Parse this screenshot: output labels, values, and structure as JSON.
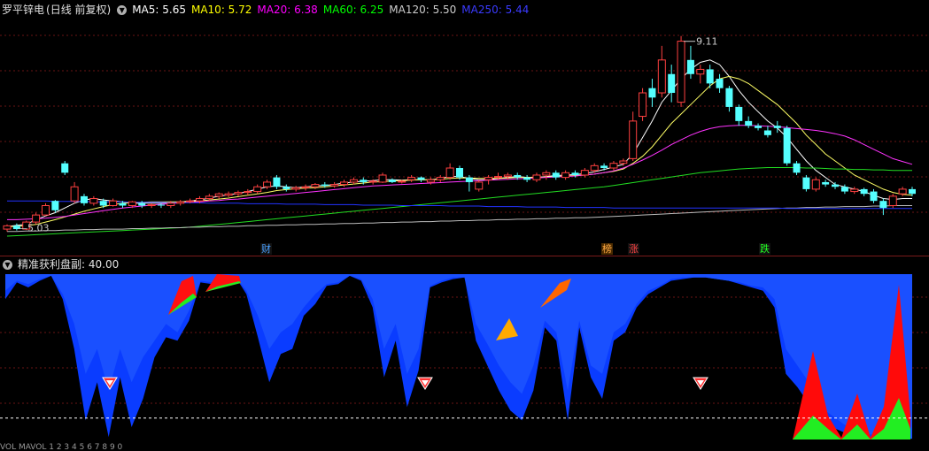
{
  "main_panel": {
    "stock_name": "罗平锌电",
    "period": "(日线 前复权)",
    "ma": [
      {
        "label": "MA5: ",
        "value": "5.65",
        "color": "#ffffff"
      },
      {
        "label": "MA10: ",
        "value": "5.72",
        "color": "#ffff00"
      },
      {
        "label": "MA20: ",
        "value": "6.38",
        "color": "#ff00ff"
      },
      {
        "label": "MA60: ",
        "value": "6.25",
        "color": "#00ff00"
      },
      {
        "label": "MA120: ",
        "value": "5.50",
        "color": "#cccccc"
      },
      {
        "label": "MA250: ",
        "value": "5.44",
        "color": "#0000ff"
      }
    ],
    "high_label": "9.11",
    "low_label": "5.03",
    "markers": [
      "财",
      "榜",
      "涨",
      "跌"
    ]
  },
  "sub_panel": {
    "indicator": "精准获利盘副",
    "value": ": 40.00"
  },
  "footer_text": "VOL MAVOL 1 2 3 4 5 6 7 8 9 0",
  "chart_data": {
    "type": "candlestick",
    "ylim": [
      4.7,
      9.5
    ],
    "candles": [
      [
        5.0,
        5.07,
        4.95,
        5.1
      ],
      [
        5.07,
        5.0,
        4.97,
        5.12
      ],
      [
        5.0,
        5.15,
        4.98,
        5.18
      ],
      [
        5.15,
        5.3,
        5.1,
        5.35
      ],
      [
        5.3,
        5.5,
        5.28,
        5.55
      ],
      [
        5.6,
        5.4,
        5.35,
        5.62
      ],
      [
        6.4,
        6.2,
        6.15,
        6.45
      ],
      [
        5.6,
        5.9,
        5.55,
        6.0
      ],
      [
        5.7,
        5.55,
        5.5,
        5.75
      ],
      [
        5.55,
        5.65,
        5.5,
        5.7
      ],
      [
        5.6,
        5.5,
        5.45,
        5.65
      ],
      [
        5.5,
        5.6,
        5.48,
        5.65
      ],
      [
        5.55,
        5.5,
        5.45,
        5.6
      ],
      [
        5.5,
        5.58,
        5.45,
        5.6
      ],
      [
        5.55,
        5.5,
        5.45,
        5.6
      ],
      [
        5.5,
        5.52,
        5.45,
        5.55
      ],
      [
        5.52,
        5.5,
        5.45,
        5.55
      ],
      [
        5.5,
        5.55,
        5.45,
        5.6
      ],
      [
        5.55,
        5.58,
        5.5,
        5.62
      ],
      [
        5.58,
        5.6,
        5.55,
        5.65
      ],
      [
        5.6,
        5.65,
        5.55,
        5.7
      ],
      [
        5.65,
        5.7,
        5.6,
        5.75
      ],
      [
        5.7,
        5.75,
        5.65,
        5.78
      ],
      [
        5.72,
        5.75,
        5.68,
        5.8
      ],
      [
        5.75,
        5.78,
        5.7,
        5.82
      ],
      [
        5.78,
        5.8,
        5.72,
        5.85
      ],
      [
        5.8,
        5.9,
        5.75,
        5.95
      ],
      [
        5.9,
        6.0,
        5.85,
        6.05
      ],
      [
        6.1,
        5.9,
        5.85,
        6.15
      ],
      [
        5.9,
        5.85,
        5.8,
        5.95
      ],
      [
        5.85,
        5.88,
        5.8,
        5.92
      ],
      [
        5.88,
        5.9,
        5.82,
        5.95
      ],
      [
        5.9,
        5.95,
        5.85,
        5.98
      ],
      [
        5.95,
        5.92,
        5.88,
        6.0
      ],
      [
        5.92,
        5.95,
        5.88,
        6.0
      ],
      [
        5.95,
        6.0,
        5.9,
        6.05
      ],
      [
        6.0,
        6.05,
        5.95,
        6.1
      ],
      [
        6.05,
        6.0,
        5.95,
        6.1
      ],
      [
        6.0,
        6.02,
        5.95,
        6.06
      ],
      [
        6.0,
        6.15,
        5.98,
        6.2
      ],
      [
        6.05,
        6.0,
        5.98,
        6.08
      ],
      [
        6.0,
        6.02,
        5.97,
        6.05
      ],
      [
        6.05,
        6.1,
        6.0,
        6.15
      ],
      [
        6.1,
        6.05,
        6.0,
        6.12
      ],
      [
        6.0,
        6.05,
        5.95,
        6.1
      ],
      [
        6.05,
        6.1,
        6.0,
        6.15
      ],
      [
        6.1,
        6.3,
        6.05,
        6.4
      ],
      [
        6.3,
        6.1,
        6.05,
        6.35
      ],
      [
        6.1,
        6.0,
        5.8,
        6.15
      ],
      [
        5.85,
        6.0,
        5.8,
        6.05
      ],
      [
        6.05,
        6.1,
        5.95,
        6.15
      ],
      [
        6.1,
        6.12,
        6.05,
        6.2
      ],
      [
        6.12,
        6.15,
        6.05,
        6.2
      ],
      [
        6.15,
        6.1,
        6.05,
        6.2
      ],
      [
        6.1,
        6.05,
        6.0,
        6.15
      ],
      [
        6.05,
        6.15,
        6.0,
        6.2
      ],
      [
        6.15,
        6.2,
        6.05,
        6.25
      ],
      [
        6.2,
        6.1,
        6.05,
        6.25
      ],
      [
        6.1,
        6.2,
        6.05,
        6.25
      ],
      [
        6.2,
        6.15,
        6.1,
        6.25
      ],
      [
        6.15,
        6.25,
        6.1,
        6.3
      ],
      [
        6.25,
        6.35,
        6.2,
        6.4
      ],
      [
        6.35,
        6.3,
        6.25,
        6.4
      ],
      [
        6.3,
        6.4,
        6.25,
        6.45
      ],
      [
        6.4,
        6.45,
        6.35,
        6.5
      ],
      [
        6.5,
        7.3,
        6.45,
        7.5
      ],
      [
        7.4,
        7.9,
        7.3,
        8.0
      ],
      [
        8.0,
        7.8,
        7.6,
        8.2
      ],
      [
        7.9,
        8.6,
        7.8,
        8.9
      ],
      [
        8.3,
        7.9,
        7.7,
        8.5
      ],
      [
        7.7,
        9.0,
        7.6,
        9.11
      ],
      [
        8.6,
        8.3,
        8.2,
        8.9
      ],
      [
        8.3,
        8.4,
        8.1,
        8.5
      ],
      [
        8.4,
        8.1,
        8.0,
        8.5
      ],
      [
        8.2,
        8.0,
        7.9,
        8.3
      ],
      [
        8.0,
        7.6,
        7.5,
        8.05
      ],
      [
        7.6,
        7.3,
        7.2,
        7.65
      ],
      [
        7.3,
        7.2,
        7.15,
        7.4
      ],
      [
        7.2,
        7.15,
        7.1,
        7.25
      ],
      [
        7.1,
        7.0,
        6.95,
        7.2
      ],
      [
        7.2,
        7.15,
        7.05,
        7.3
      ],
      [
        7.15,
        6.4,
        6.35,
        7.2
      ],
      [
        6.4,
        6.2,
        6.15,
        6.45
      ],
      [
        6.1,
        5.85,
        5.8,
        6.15
      ],
      [
        5.85,
        6.05,
        5.8,
        6.1
      ],
      [
        6.0,
        5.95,
        5.9,
        6.05
      ],
      [
        5.95,
        5.9,
        5.85,
        6.0
      ],
      [
        5.9,
        5.8,
        5.75,
        5.95
      ],
      [
        5.8,
        5.85,
        5.75,
        5.9
      ],
      [
        5.85,
        5.75,
        5.7,
        5.88
      ],
      [
        5.8,
        5.6,
        5.55,
        5.85
      ],
      [
        5.6,
        5.45,
        5.3,
        5.65
      ],
      [
        5.5,
        5.7,
        5.45,
        5.75
      ],
      [
        5.75,
        5.85,
        5.7,
        5.9
      ],
      [
        5.85,
        5.75,
        5.7,
        5.9
      ]
    ],
    "ma_series": {
      "ma5": [
        5.05,
        5.08,
        5.1,
        5.2,
        5.28,
        5.35,
        5.45,
        5.55,
        5.62,
        5.65,
        5.62,
        5.6,
        5.58,
        5.55,
        5.55,
        5.55,
        5.55,
        5.56,
        5.58,
        5.6,
        5.62,
        5.66,
        5.7,
        5.73,
        5.76,
        5.8,
        5.85,
        5.9,
        5.92,
        5.9,
        5.88,
        5.9,
        5.92,
        5.93,
        5.95,
        5.98,
        6.0,
        6.02,
        6.03,
        6.05,
        6.05,
        6.04,
        6.05,
        6.05,
        6.05,
        6.08,
        6.12,
        6.12,
        6.08,
        6.05,
        6.05,
        6.08,
        6.1,
        6.12,
        6.1,
        6.1,
        6.12,
        6.14,
        6.15,
        6.16,
        6.18,
        6.22,
        6.27,
        6.32,
        6.38,
        6.6,
        6.95,
        7.3,
        7.7,
        7.95,
        8.2,
        8.4,
        8.55,
        8.6,
        8.5,
        8.25,
        7.95,
        7.7,
        7.5,
        7.3,
        7.15,
        6.95,
        6.7,
        6.45,
        6.25,
        6.1,
        5.95,
        5.9,
        5.85,
        5.8,
        5.72,
        5.65,
        5.63,
        5.65,
        5.65
      ],
      "ma10": [
        5.05,
        5.06,
        5.07,
        5.1,
        5.15,
        5.2,
        5.26,
        5.32,
        5.38,
        5.43,
        5.48,
        5.52,
        5.55,
        5.56,
        5.57,
        5.58,
        5.58,
        5.58,
        5.58,
        5.59,
        5.6,
        5.62,
        5.64,
        5.66,
        5.69,
        5.72,
        5.75,
        5.78,
        5.82,
        5.84,
        5.86,
        5.87,
        5.88,
        5.9,
        5.92,
        5.94,
        5.96,
        5.98,
        6.0,
        6.01,
        6.02,
        6.03,
        6.04,
        6.05,
        6.05,
        6.06,
        6.08,
        6.09,
        6.09,
        6.08,
        6.08,
        6.08,
        6.09,
        6.1,
        6.1,
        6.1,
        6.11,
        6.12,
        6.13,
        6.14,
        6.15,
        6.17,
        6.2,
        6.23,
        6.28,
        6.4,
        6.55,
        6.75,
        7.0,
        7.25,
        7.45,
        7.65,
        7.85,
        8.05,
        8.2,
        8.25,
        8.2,
        8.1,
        7.95,
        7.8,
        7.65,
        7.45,
        7.25,
        7.0,
        6.8,
        6.6,
        6.45,
        6.3,
        6.15,
        6.05,
        5.95,
        5.85,
        5.78,
        5.74,
        5.72
      ],
      "ma20": [
        5.2,
        5.2,
        5.21,
        5.22,
        5.23,
        5.25,
        5.27,
        5.3,
        5.33,
        5.36,
        5.39,
        5.42,
        5.45,
        5.47,
        5.49,
        5.51,
        5.53,
        5.54,
        5.56,
        5.57,
        5.58,
        5.6,
        5.61,
        5.63,
        5.64,
        5.66,
        5.68,
        5.7,
        5.72,
        5.74,
        5.76,
        5.78,
        5.8,
        5.82,
        5.84,
        5.86,
        5.88,
        5.9,
        5.92,
        5.93,
        5.94,
        5.95,
        5.96,
        5.97,
        5.98,
        5.99,
        6.0,
        6.01,
        6.02,
        6.03,
        6.04,
        6.05,
        6.06,
        6.07,
        6.08,
        6.09,
        6.1,
        6.11,
        6.12,
        6.13,
        6.15,
        6.17,
        6.2,
        6.24,
        6.3,
        6.38,
        6.47,
        6.57,
        6.68,
        6.8,
        6.9,
        7.0,
        7.08,
        7.14,
        7.18,
        7.2,
        7.21,
        7.21,
        7.2,
        7.19,
        7.18,
        7.16,
        7.14,
        7.12,
        7.1,
        7.07,
        7.03,
        6.98,
        6.9,
        6.8,
        6.7,
        6.6,
        6.5,
        6.44,
        6.38
      ],
      "ma60": [
        4.85,
        4.86,
        4.87,
        4.88,
        4.89,
        4.9,
        4.91,
        4.92,
        4.93,
        4.94,
        4.95,
        4.96,
        4.97,
        4.98,
        4.99,
        5.0,
        5.01,
        5.02,
        5.03,
        5.04,
        5.06,
        5.08,
        5.1,
        5.12,
        5.14,
        5.16,
        5.18,
        5.2,
        5.22,
        5.24,
        5.26,
        5.28,
        5.3,
        5.32,
        5.34,
        5.36,
        5.38,
        5.4,
        5.42,
        5.44,
        5.46,
        5.48,
        5.5,
        5.52,
        5.54,
        5.56,
        5.58,
        5.6,
        5.62,
        5.64,
        5.66,
        5.68,
        5.7,
        5.72,
        5.74,
        5.76,
        5.78,
        5.8,
        5.82,
        5.84,
        5.86,
        5.88,
        5.9,
        5.93,
        5.96,
        5.99,
        6.02,
        6.05,
        6.08,
        6.11,
        6.14,
        6.17,
        6.2,
        6.22,
        6.24,
        6.26,
        6.28,
        6.29,
        6.3,
        6.31,
        6.31,
        6.31,
        6.31,
        6.3,
        6.3,
        6.29,
        6.28,
        6.28,
        6.27,
        6.27,
        6.26,
        6.26,
        6.25,
        6.25,
        6.25
      ],
      "ma120": [
        4.95,
        4.95,
        4.96,
        4.96,
        4.97,
        4.97,
        4.98,
        4.98,
        4.99,
        4.99,
        5.0,
        5.0,
        5.0,
        5.01,
        5.01,
        5.02,
        5.02,
        5.03,
        5.03,
        5.04,
        5.04,
        5.05,
        5.05,
        5.06,
        5.06,
        5.07,
        5.07,
        5.08,
        5.08,
        5.09,
        5.09,
        5.1,
        5.1,
        5.11,
        5.11,
        5.12,
        5.12,
        5.13,
        5.13,
        5.14,
        5.14,
        5.15,
        5.15,
        5.16,
        5.16,
        5.17,
        5.17,
        5.18,
        5.18,
        5.19,
        5.19,
        5.2,
        5.2,
        5.21,
        5.21,
        5.22,
        5.22,
        5.23,
        5.23,
        5.24,
        5.24,
        5.25,
        5.26,
        5.27,
        5.28,
        5.29,
        5.3,
        5.31,
        5.32,
        5.33,
        5.34,
        5.35,
        5.36,
        5.37,
        5.38,
        5.39,
        5.4,
        5.41,
        5.42,
        5.43,
        5.44,
        5.45,
        5.45,
        5.46,
        5.46,
        5.47,
        5.47,
        5.48,
        5.48,
        5.48,
        5.49,
        5.49,
        5.5,
        5.5,
        5.5
      ],
      "ma250": [
        5.6,
        5.6,
        5.6,
        5.6,
        5.6,
        5.59,
        5.59,
        5.59,
        5.59,
        5.58,
        5.58,
        5.58,
        5.58,
        5.57,
        5.57,
        5.57,
        5.57,
        5.56,
        5.56,
        5.56,
        5.56,
        5.55,
        5.55,
        5.55,
        5.55,
        5.54,
        5.54,
        5.54,
        5.54,
        5.53,
        5.53,
        5.53,
        5.53,
        5.52,
        5.52,
        5.52,
        5.52,
        5.51,
        5.51,
        5.51,
        5.51,
        5.5,
        5.5,
        5.5,
        5.5,
        5.5,
        5.49,
        5.49,
        5.49,
        5.49,
        5.48,
        5.48,
        5.48,
        5.48,
        5.47,
        5.47,
        5.47,
        5.47,
        5.46,
        5.46,
        5.46,
        5.46,
        5.46,
        5.45,
        5.45,
        5.45,
        5.45,
        5.45,
        5.45,
        5.45,
        5.45,
        5.45,
        5.45,
        5.45,
        5.45,
        5.45,
        5.45,
        5.45,
        5.45,
        5.45,
        5.45,
        5.44,
        5.44,
        5.44,
        5.44,
        5.44,
        5.44,
        5.44,
        5.44,
        5.44,
        5.44,
        5.44,
        5.44,
        5.44,
        5.44
      ]
    },
    "sub_series": {
      "ylim": [
        0,
        100
      ],
      "dashed_level": 40,
      "blue_outer": [
        85,
        95,
        92,
        96,
        99,
        85,
        55,
        12,
        35,
        2,
        38,
        8,
        25,
        50,
        62,
        60,
        72,
        95,
        94,
        96,
        99,
        88,
        62,
        35,
        52,
        55,
        75,
        82,
        93,
        94,
        99,
        96,
        80,
        38,
        60,
        20,
        42,
        92,
        95,
        97,
        98,
        60,
        45,
        30,
        18,
        12,
        30,
        68,
        60,
        12,
        68,
        38,
        25,
        60,
        65,
        80,
        88,
        92,
        96,
        97,
        98,
        98,
        97,
        96,
        94,
        92,
        90,
        80,
        40,
        32,
        22,
        10,
        8,
        5,
        3,
        2,
        1,
        1,
        1,
        1
      ],
      "blue_inner": [
        90,
        96,
        94,
        97,
        99,
        88,
        70,
        40,
        55,
        30,
        55,
        35,
        50,
        60,
        70,
        65,
        78,
        96,
        95,
        97,
        99,
        90,
        75,
        55,
        65,
        70,
        80,
        88,
        94,
        95,
        99,
        97,
        85,
        55,
        70,
        40,
        55,
        93,
        96,
        98,
        98,
        70,
        58,
        45,
        35,
        28,
        45,
        72,
        65,
        30,
        72,
        45,
        40,
        65,
        70,
        82,
        90,
        93,
        97,
        98,
        98,
        98,
        97,
        96,
        95,
        93,
        92,
        85,
        55,
        45,
        35,
        20,
        15,
        10,
        6,
        4,
        3,
        2,
        2,
        1
      ],
      "red": [
        0,
        0,
        0,
        0,
        0,
        0,
        0,
        0,
        0,
        0,
        0,
        0,
        0,
        0,
        0,
        0,
        0,
        0,
        0,
        0,
        0,
        0,
        0,
        0,
        0,
        0,
        0,
        0,
        0,
        0,
        0,
        0,
        0,
        0,
        0,
        0,
        0,
        0,
        0,
        0,
        0,
        0,
        0,
        0,
        0,
        0,
        0,
        0,
        0,
        0,
        0,
        0,
        0,
        0,
        0,
        0,
        0,
        0,
        0,
        0,
        0,
        0,
        0,
        0,
        0,
        0,
        0,
        0,
        0,
        0,
        0,
        0,
        0,
        0,
        0,
        0,
        0,
        0,
        0,
        0
      ]
    },
    "sub_profit_area": [
      {
        "x": 900,
        "y0": 497,
        "y": 470
      },
      {
        "x": 918,
        "y0": 497,
        "y": 398
      },
      {
        "x": 935,
        "y0": 497,
        "y": 470
      },
      {
        "x": 953,
        "y0": 497,
        "y": 490
      },
      {
        "x": 968,
        "y0": 497,
        "y": 445
      },
      {
        "x": 983,
        "y0": 497,
        "y": 490
      },
      {
        "x": 1000,
        "y0": 497,
        "y": 460
      },
      {
        "x": 1015,
        "y0": 497,
        "y": 322
      },
      {
        "x": 1028,
        "y0": 497,
        "y": 470
      }
    ]
  }
}
